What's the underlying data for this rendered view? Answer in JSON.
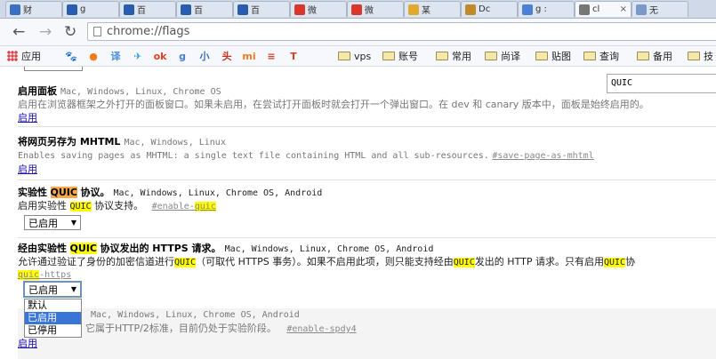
{
  "tabs": [
    {
      "title": "财",
      "color": "#3b6fc4",
      "active": false
    },
    {
      "title": "g",
      "color": "#2a5db0",
      "active": false
    },
    {
      "title": "百",
      "color": "#2a5db0",
      "active": false
    },
    {
      "title": "百",
      "color": "#2a5db0",
      "active": false
    },
    {
      "title": "百",
      "color": "#2a5db0",
      "active": false
    },
    {
      "title": "微",
      "color": "#d9372c",
      "active": false
    },
    {
      "title": "微",
      "color": "#d9372c",
      "active": false
    },
    {
      "title": "某",
      "color": "#e3a92c",
      "active": false
    },
    {
      "title": "Dc",
      "color": "#c08a2a",
      "active": false
    },
    {
      "title": "g :",
      "color": "#4a80d6",
      "active": false
    },
    {
      "title": "cl",
      "color": "#777777",
      "active": true
    },
    {
      "title": "无",
      "color": "#7a98c8",
      "active": false
    }
  ],
  "toolbar": {
    "back_icon": "←",
    "forward_icon": "→",
    "reload_icon": "↻",
    "url": "chrome://flags"
  },
  "bookmarks": {
    "apps_label": "应用",
    "icons": [
      {
        "name": "baidu-paw-icon",
        "color": "#2a5db0",
        "glyph": "🐾"
      },
      {
        "name": "orange-bookmark-icon",
        "color": "#f07c1e",
        "glyph": "●"
      },
      {
        "name": "translate-icon",
        "color": "#4a8fe0",
        "glyph": "译"
      },
      {
        "name": "bird-icon",
        "color": "#2aa0e0",
        "glyph": "✈"
      },
      {
        "name": "ok-icon",
        "color": "#e04020",
        "glyph": "ok"
      },
      {
        "name": "google-icon",
        "color": "#4a80d6",
        "glyph": "g"
      },
      {
        "name": "xiao-icon",
        "color": "#3b6fc4",
        "glyph": "小"
      },
      {
        "name": "hua-icon",
        "color": "#c83020",
        "glyph": "头"
      },
      {
        "name": "mi-icon",
        "color": "#f07c1e",
        "glyph": "mi"
      },
      {
        "name": "stack-icon",
        "color": "#d04030",
        "glyph": "≡"
      },
      {
        "name": "t-icon",
        "color": "#d83b2a",
        "glyph": "T"
      }
    ],
    "folders": [
      "vps",
      "账号",
      "常用",
      "尚译",
      "贴图",
      "查询",
      "备用",
      "技"
    ]
  },
  "find_bar": {
    "value": "QUIC"
  },
  "flags": {
    "panels": {
      "name": "启用面板",
      "platforms": "Mac, Windows, Linux, Chrome OS",
      "desc": "启用在浏览器框架之外打开的面板窗口。如果未启用，在尝试打开面板时就会打开一个弹出窗口。在 dev 和 canary 版本中，面板是始终启用的。",
      "link": "启用"
    },
    "mhtml": {
      "name": "将网页另存为 MHTML",
      "platforms": "Mac, Windows, Linux",
      "desc": "Enables saving pages as MHTML: a single text file containing HTML and all sub-resources.",
      "anchor": "#save-page-as-mhtml",
      "link": "启用"
    },
    "quic": {
      "name_pre": "实验性",
      "name_hl": "QUIC",
      "name_post": "协议。",
      "platforms": "Mac, Windows, Linux, Chrome OS, Android",
      "desc_pre": "启用实验性",
      "desc_hl": "QUIC",
      "desc_post": "协议支持。",
      "anchor_pre": "#enable-",
      "anchor_hl": "quic",
      "select_value": "已启用"
    },
    "quic_https": {
      "name_pre": "经由实验性",
      "name_hl": "QUIC",
      "name_post": "协议发出的 HTTPS 请求。",
      "platforms": "Mac, Windows, Linux, Chrome OS, Android",
      "desc_1": "允许通过验证了身份的加密信道进行",
      "desc_hl1": "QUIC",
      "desc_2": "（可取代 HTTPS 事务）。如果不启用此项，则只能支持经由",
      "desc_hl2": "QUIC",
      "desc_3": "发出的 HTTP 请求。只有启用",
      "desc_hl3": "QUIC",
      "desc_4": "协",
      "anchor_hl": "quic",
      "anchor_post": "-https",
      "select_value": "已启用",
      "options": [
        "默认",
        "已启用",
        "已停用"
      ]
    },
    "spdy4": {
      "platforms": "Mac, Windows, Linux, Chrome OS, Android",
      "desc": "它属于HTTP/2标准，目前仍处于实验阶段。",
      "anchor": "#enable-spdy4",
      "link": "启用"
    }
  },
  "colors": {
    "highlight": "#ffff00",
    "active_match": "#f7a84a",
    "link": "#1a0dab",
    "selected_option": "#3875d7"
  }
}
